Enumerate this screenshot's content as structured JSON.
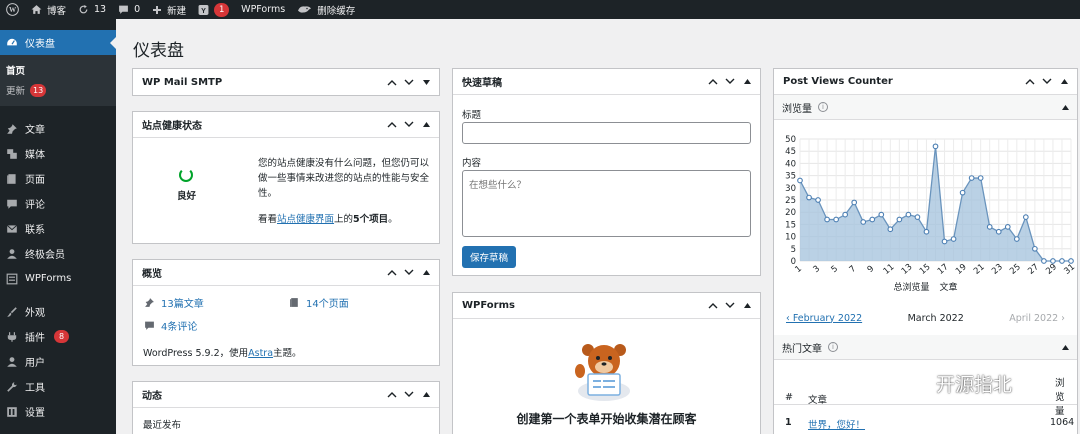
{
  "admin_bar": {
    "site_name": "博客",
    "updates_count": "13",
    "comments_count": "0",
    "new_label": "新建",
    "yoast_badge": "1",
    "wpforms_label": "WPForms",
    "clear_cache_label": "删除缓存"
  },
  "sidebar": {
    "dashboard": "仪表盘",
    "home": "首页",
    "updates": "更新",
    "updates_badge": "13",
    "posts": "文章",
    "media": "媒体",
    "pages": "页面",
    "comments": "评论",
    "contact": "联系",
    "ultimate_member": "终极会员",
    "wpforms": "WPForms",
    "appearance": "外观",
    "plugins": "插件",
    "plugins_badge": "8",
    "users": "用户",
    "tools": "工具",
    "settings": "设置"
  },
  "page_title": "仪表盘",
  "smtp_box": {
    "title": "WP Mail SMTP"
  },
  "health_box": {
    "title": "站点健康状态",
    "status": "良好",
    "desc": "您的站点健康没有什么问题，但您仍可以做一些事情来改进您的站点的性能与安全性。",
    "look_prefix": "看看",
    "look_link": "站点健康界面",
    "look_middle": "上的",
    "look_count": "5个项目",
    "look_suffix": "。"
  },
  "overview_box": {
    "title": "概览",
    "posts": "13篇文章",
    "pages": "14个页面",
    "comments": "4条评论",
    "wp_prefix": "WordPress 5.9.2，使用",
    "theme_link": "Astra",
    "wp_suffix": "主题。"
  },
  "activity_box": {
    "title": "动态",
    "recent": "最近发布"
  },
  "quick_draft": {
    "title": "快速草稿",
    "title_label": "标题",
    "content_label": "内容",
    "content_placeholder": "在想些什么？",
    "save_button": "保存草稿"
  },
  "wpforms_box": {
    "title": "WPForms",
    "headline": "创建第一个表单开始收集潜在顾客"
  },
  "pvc_box": {
    "title": "Post Views Counter",
    "views_title": "浏览量",
    "legend_total": "总浏览量",
    "legend_posts": "文章",
    "prev_month": "‹ February 2022",
    "current_month": "March 2022",
    "next_month": "April 2022 ›",
    "popular_title": "热门文章",
    "col_num": "#",
    "col_post": "文章",
    "col_views": "浏览量",
    "top_num": "1",
    "top_post": "世界，您好！",
    "top_views": "1064"
  },
  "watermark": {
    "text": "开源指北"
  },
  "colors": {
    "admin_bar": "#1d2327",
    "accent": "#2271b1",
    "badge": "#d63638",
    "chart_fill": "#a3c2dc"
  },
  "chart_data": {
    "type": "area",
    "x": [
      1,
      2,
      3,
      4,
      5,
      6,
      7,
      8,
      9,
      10,
      11,
      12,
      13,
      14,
      15,
      16,
      17,
      18,
      19,
      20,
      21,
      22,
      23,
      24,
      25,
      26,
      27,
      28,
      29,
      30,
      31
    ],
    "x_tick_labels": [
      "1",
      "3",
      "5",
      "7",
      "9",
      "11",
      "13",
      "15",
      "17",
      "19",
      "21",
      "23",
      "25",
      "27",
      "29",
      "31"
    ],
    "series": [
      {
        "name": "总浏览量",
        "values": [
          33,
          26,
          25,
          17,
          17,
          19,
          24,
          16,
          17,
          19,
          13,
          17,
          19,
          18,
          12,
          47,
          8,
          9,
          28,
          34,
          34,
          14,
          12,
          14,
          9,
          18,
          5,
          0,
          0,
          0,
          0
        ]
      }
    ],
    "ylim": [
      0,
      50
    ],
    "y_ticks": [
      0,
      5,
      10,
      15,
      20,
      25,
      30,
      35,
      40,
      45,
      50
    ],
    "grid": true,
    "legend": "bottom"
  }
}
